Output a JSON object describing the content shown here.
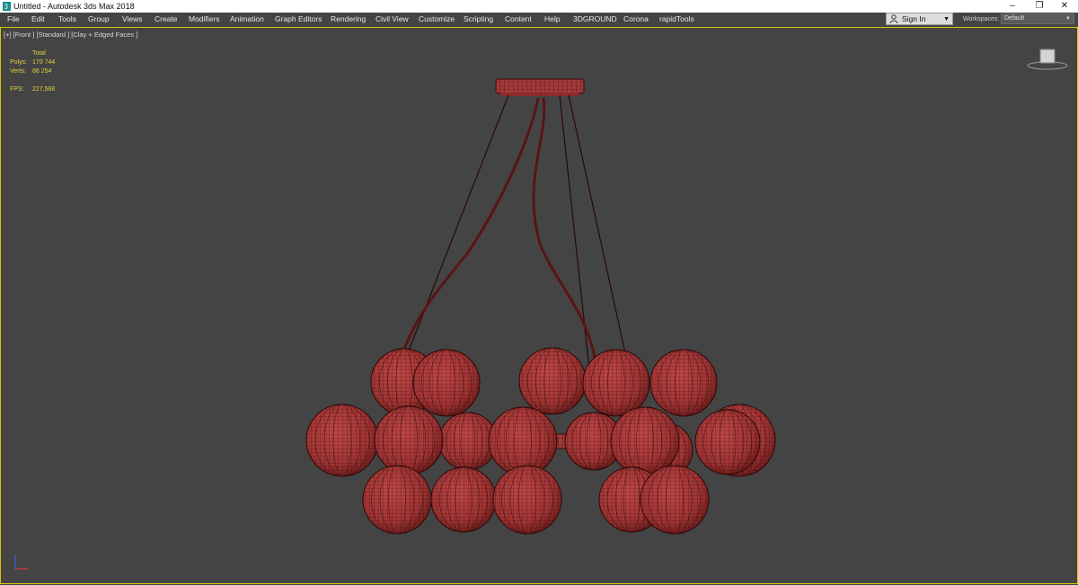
{
  "titlebar": {
    "title": "Untitled - Autodesk 3ds Max 2018",
    "minimize": "–",
    "restore": "❐",
    "close": "✕"
  },
  "menu": [
    "File",
    "Edit",
    "Tools",
    "Group",
    "Views",
    "Create",
    "Modifiers",
    "Animation",
    "Graph Editors",
    "Rendering",
    "Civil View",
    "Customize",
    "Scripting",
    "Content",
    "Help",
    "3DGROUND",
    "Corona",
    "rapidTools"
  ],
  "signin": {
    "label": "Sign In",
    "icon": "user-icon"
  },
  "workspaces": {
    "label": "Workspaces:",
    "value": "Default"
  },
  "viewport": {
    "label": "[+] [Front ] [Standard ] [Clay + Edged Faces ]",
    "stats": {
      "header": "Total",
      "polys_label": "Polys:",
      "polys": "170 744",
      "verts_label": "Verts:",
      "verts": "86 254",
      "fps_label": "FPS:",
      "fps": "227,568"
    }
  },
  "colors": {
    "accent": "#d9c400",
    "background": "#444444",
    "model": "#a53a3a",
    "wire": "#2a0a0a"
  }
}
